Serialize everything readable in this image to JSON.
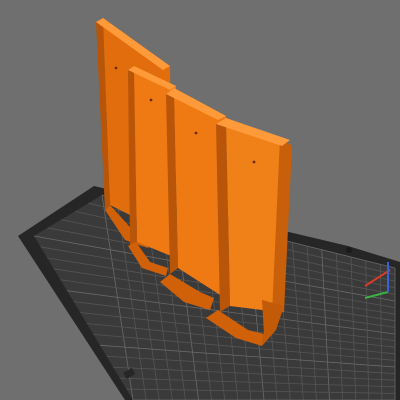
{
  "viewport": {
    "background_color": "#6f6f6f",
    "plate_frame_color": "#262626",
    "plate_surface_color": "#3a3a3a",
    "grid_line_color": "#555555",
    "grid_major_line_color": "#6a6a6a"
  },
  "model": {
    "color": "#e26d0c",
    "face_light": "#f08018",
    "face_shadow": "#b85508",
    "edge_highlight": "#ff9a3a",
    "panel_count": 4
  },
  "axes_gizmo": {
    "x_color": "#d63c2a",
    "y_color": "#3cb043",
    "z_color": "#3a62d6"
  }
}
